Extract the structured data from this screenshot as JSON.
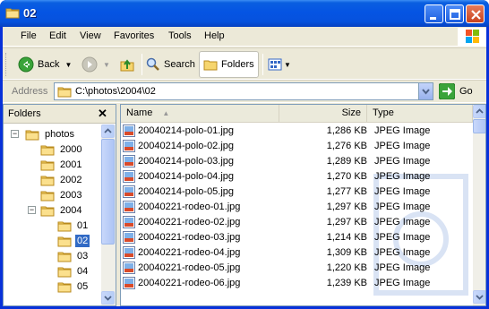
{
  "window": {
    "title": "02"
  },
  "menu": [
    "File",
    "Edit",
    "View",
    "Favorites",
    "Tools",
    "Help"
  ],
  "toolbar": {
    "back_label": "Back",
    "search_label": "Search",
    "folders_label": "Folders"
  },
  "address": {
    "label": "Address",
    "value": "C:\\photos\\2004\\02",
    "go_label": "Go"
  },
  "folders_pane": {
    "title": "Folders",
    "tree": [
      {
        "label": "photos",
        "level": 0,
        "expander": "−",
        "selected": false
      },
      {
        "label": "2000",
        "level": 1,
        "expander": "",
        "selected": false
      },
      {
        "label": "2001",
        "level": 1,
        "expander": "",
        "selected": false
      },
      {
        "label": "2002",
        "level": 1,
        "expander": "",
        "selected": false
      },
      {
        "label": "2003",
        "level": 1,
        "expander": "",
        "selected": false
      },
      {
        "label": "2004",
        "level": 1,
        "expander": "−",
        "selected": false
      },
      {
        "label": "01",
        "level": 2,
        "expander": "",
        "selected": false
      },
      {
        "label": "02",
        "level": 2,
        "expander": "",
        "selected": true
      },
      {
        "label": "03",
        "level": 2,
        "expander": "",
        "selected": false
      },
      {
        "label": "04",
        "level": 2,
        "expander": "",
        "selected": false
      },
      {
        "label": "05",
        "level": 2,
        "expander": "",
        "selected": false
      }
    ]
  },
  "file_list": {
    "columns": {
      "name": "Name",
      "size": "Size",
      "type": "Type"
    },
    "rows": [
      {
        "name": "20040214-polo-01.jpg",
        "size": "1,286 KB",
        "type": "JPEG Image"
      },
      {
        "name": "20040214-polo-02.jpg",
        "size": "1,276 KB",
        "type": "JPEG Image"
      },
      {
        "name": "20040214-polo-03.jpg",
        "size": "1,289 KB",
        "type": "JPEG Image"
      },
      {
        "name": "20040214-polo-04.jpg",
        "size": "1,270 KB",
        "type": "JPEG Image"
      },
      {
        "name": "20040214-polo-05.jpg",
        "size": "1,277 KB",
        "type": "JPEG Image"
      },
      {
        "name": "20040221-rodeo-01.jpg",
        "size": "1,297 KB",
        "type": "JPEG Image"
      },
      {
        "name": "20040221-rodeo-02.jpg",
        "size": "1,297 KB",
        "type": "JPEG Image"
      },
      {
        "name": "20040221-rodeo-03.jpg",
        "size": "1,214 KB",
        "type": "JPEG Image"
      },
      {
        "name": "20040221-rodeo-04.jpg",
        "size": "1,309 KB",
        "type": "JPEG Image"
      },
      {
        "name": "20040221-rodeo-05.jpg",
        "size": "1,220 KB",
        "type": "JPEG Image"
      },
      {
        "name": "20040221-rodeo-06.jpg",
        "size": "1,239 KB",
        "type": "JPEG Image"
      }
    ]
  }
}
